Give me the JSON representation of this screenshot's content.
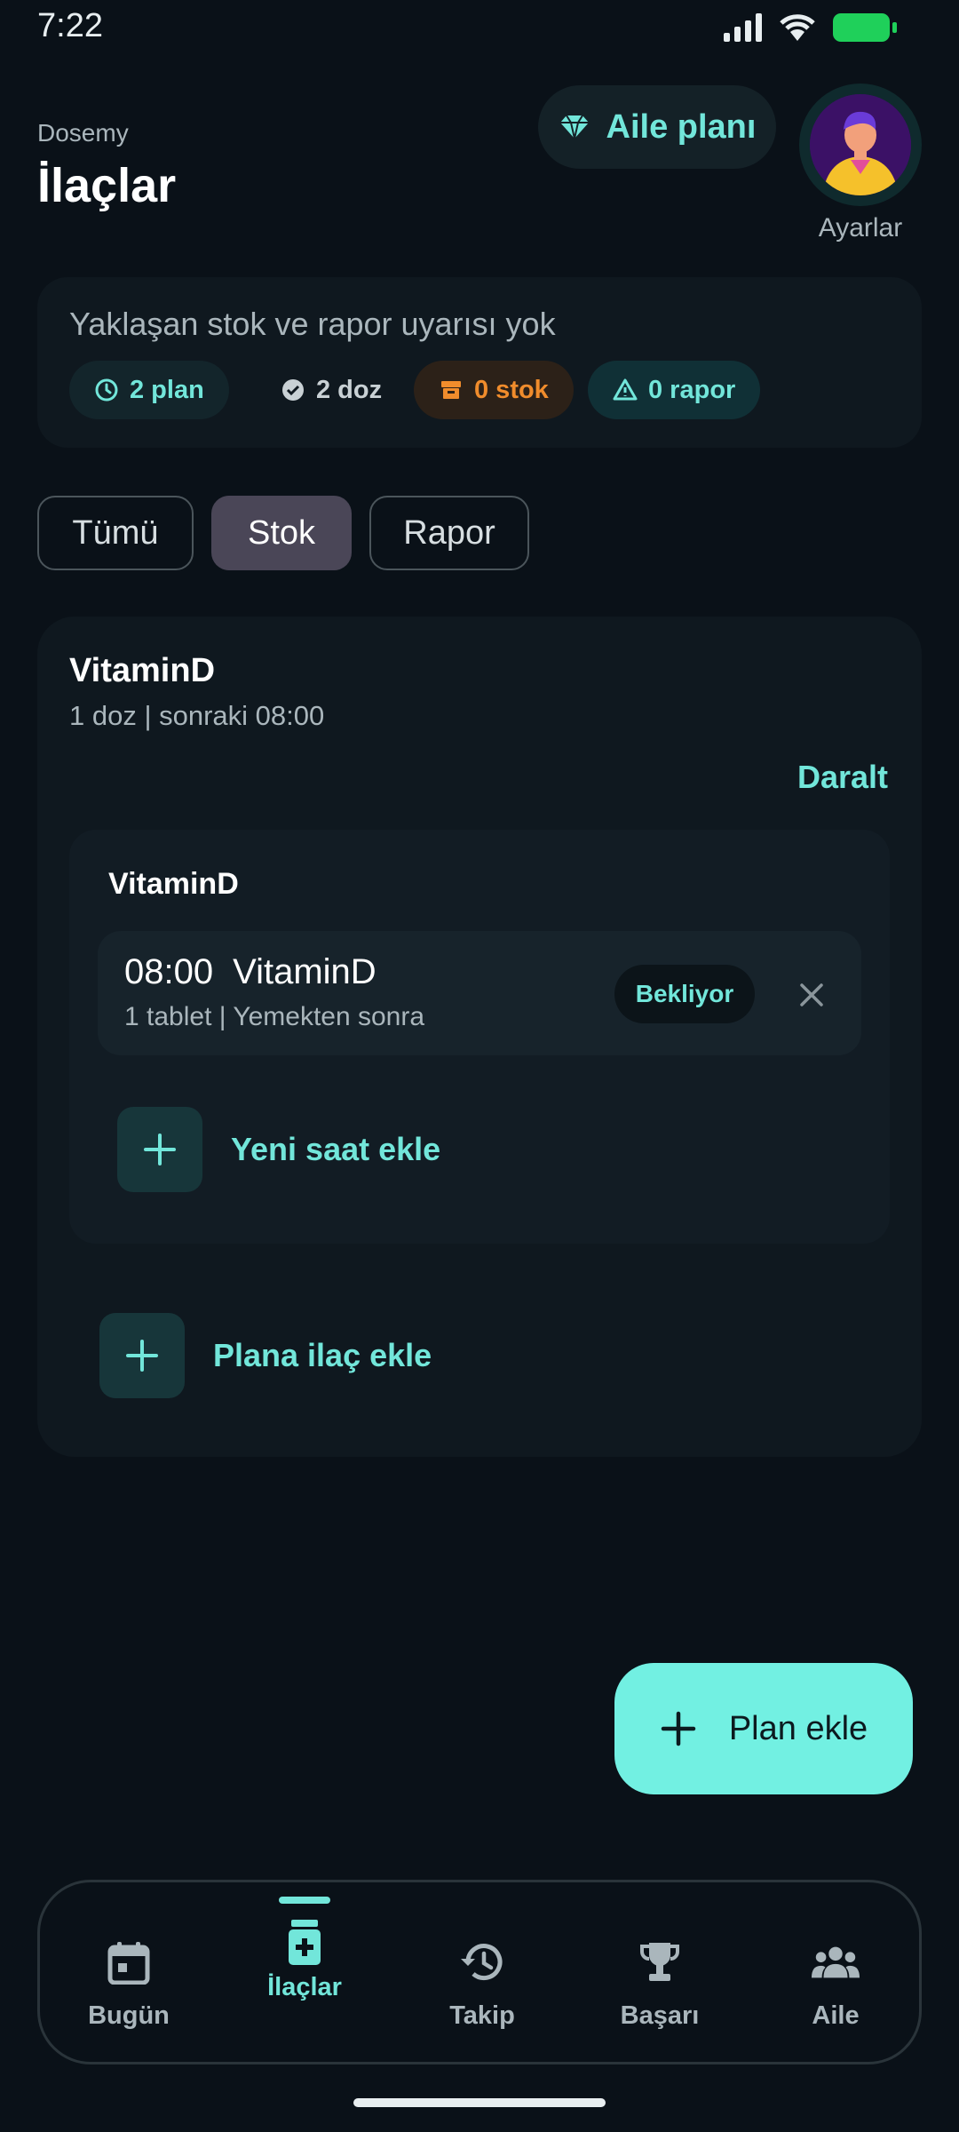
{
  "status_bar": {
    "time": "7:22"
  },
  "header": {
    "brand": "Dosemy",
    "title": "İlaçlar",
    "family_plan_label": "Aile planı",
    "settings_label": "Ayarlar"
  },
  "alerts": {
    "message": "Yaklaşan stok ve rapor uyarısı yok",
    "chips": {
      "plan": "2 plan",
      "dose": "2 doz",
      "stock": "0 stok",
      "report": "0 rapor"
    }
  },
  "filters": {
    "all": "Tümü",
    "stock": "Stok",
    "report": "Rapor",
    "selected": "Stok"
  },
  "plan": {
    "title": "VitaminD",
    "subtitle": "1 doz | sonraki 08:00",
    "collapse_label": "Daralt",
    "medication": {
      "name": "VitaminD",
      "dose": {
        "time": "08:00",
        "name": "VitaminD",
        "detail": "1 tablet | Yemekten sonra",
        "status": "Bekliyor"
      },
      "add_time_label": "Yeni saat ekle"
    },
    "add_medication_label": "Plana ilaç ekle"
  },
  "fab": {
    "label": "Plan ekle"
  },
  "nav": {
    "today": "Bugün",
    "medications": "İlaçlar",
    "tracking": "Takip",
    "achievements": "Başarı",
    "family": "Aile",
    "active": "İlaçlar"
  },
  "colors": {
    "accent": "#72e6da",
    "background": "#0a1118",
    "card": "#0f181f",
    "warning": "#f08c2c",
    "battery": "#1fd05a"
  }
}
